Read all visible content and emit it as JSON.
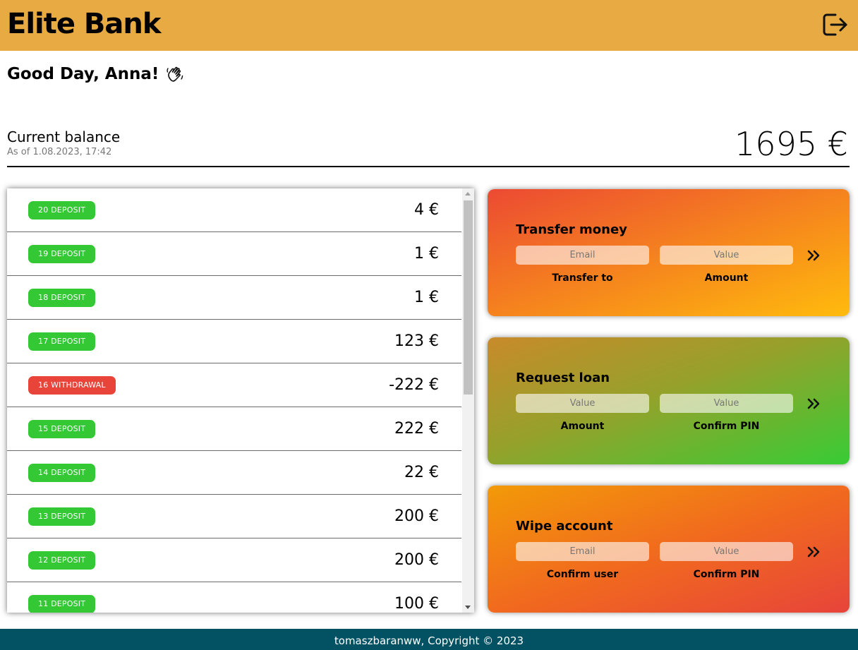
{
  "header": {
    "title": "Elite Bank",
    "logout_icon": "logout-icon"
  },
  "greeting": {
    "text": "Good Day, Anna!",
    "icon": "waving-hand-icon"
  },
  "balance": {
    "label": "Current balance",
    "date": "As of 1.08.2023, 17:42",
    "value": "1695 €"
  },
  "movements": [
    {
      "type": "deposit",
      "label": "20 DEPOSIT",
      "amount": "4 €"
    },
    {
      "type": "deposit",
      "label": "19 DEPOSIT",
      "amount": "1 €"
    },
    {
      "type": "deposit",
      "label": "18 DEPOSIT",
      "amount": "1 €"
    },
    {
      "type": "deposit",
      "label": "17 DEPOSIT",
      "amount": "123 €"
    },
    {
      "type": "withdrawal",
      "label": "16 WITHDRAWAL",
      "amount": "-222 €"
    },
    {
      "type": "deposit",
      "label": "15 DEPOSIT",
      "amount": "222 €"
    },
    {
      "type": "deposit",
      "label": "14 DEPOSIT",
      "amount": "22 €"
    },
    {
      "type": "deposit",
      "label": "13 DEPOSIT",
      "amount": "200 €"
    },
    {
      "type": "deposit",
      "label": "12 DEPOSIT",
      "amount": "200 €"
    },
    {
      "type": "deposit",
      "label": "11 DEPOSIT",
      "amount": "100 €"
    }
  ],
  "operations": {
    "transfer": {
      "title": "Transfer money",
      "input_a_placeholder": "Email",
      "input_b_placeholder": "Value",
      "label_a": "Transfer to",
      "label_b": "Amount",
      "button_icon": "double-chevron-right-icon"
    },
    "loan": {
      "title": "Request loan",
      "input_a_placeholder": "Value",
      "input_b_placeholder": "Value",
      "label_a": "Amount",
      "label_b": "Confirm PIN",
      "button_icon": "double-chevron-right-icon"
    },
    "close": {
      "title": "Wipe account",
      "input_a_placeholder": "Email",
      "input_b_placeholder": "Value",
      "label_a": "Confirm user",
      "label_b": "Confirm PIN",
      "button_icon": "double-chevron-right-icon"
    }
  },
  "footer": {
    "text": "tomaszbaranww, Copyright © 2023"
  },
  "colors": {
    "header": "#e8aa42",
    "deposit": "#34c934",
    "withdrawal": "#e8443a",
    "footer": "#025264"
  }
}
